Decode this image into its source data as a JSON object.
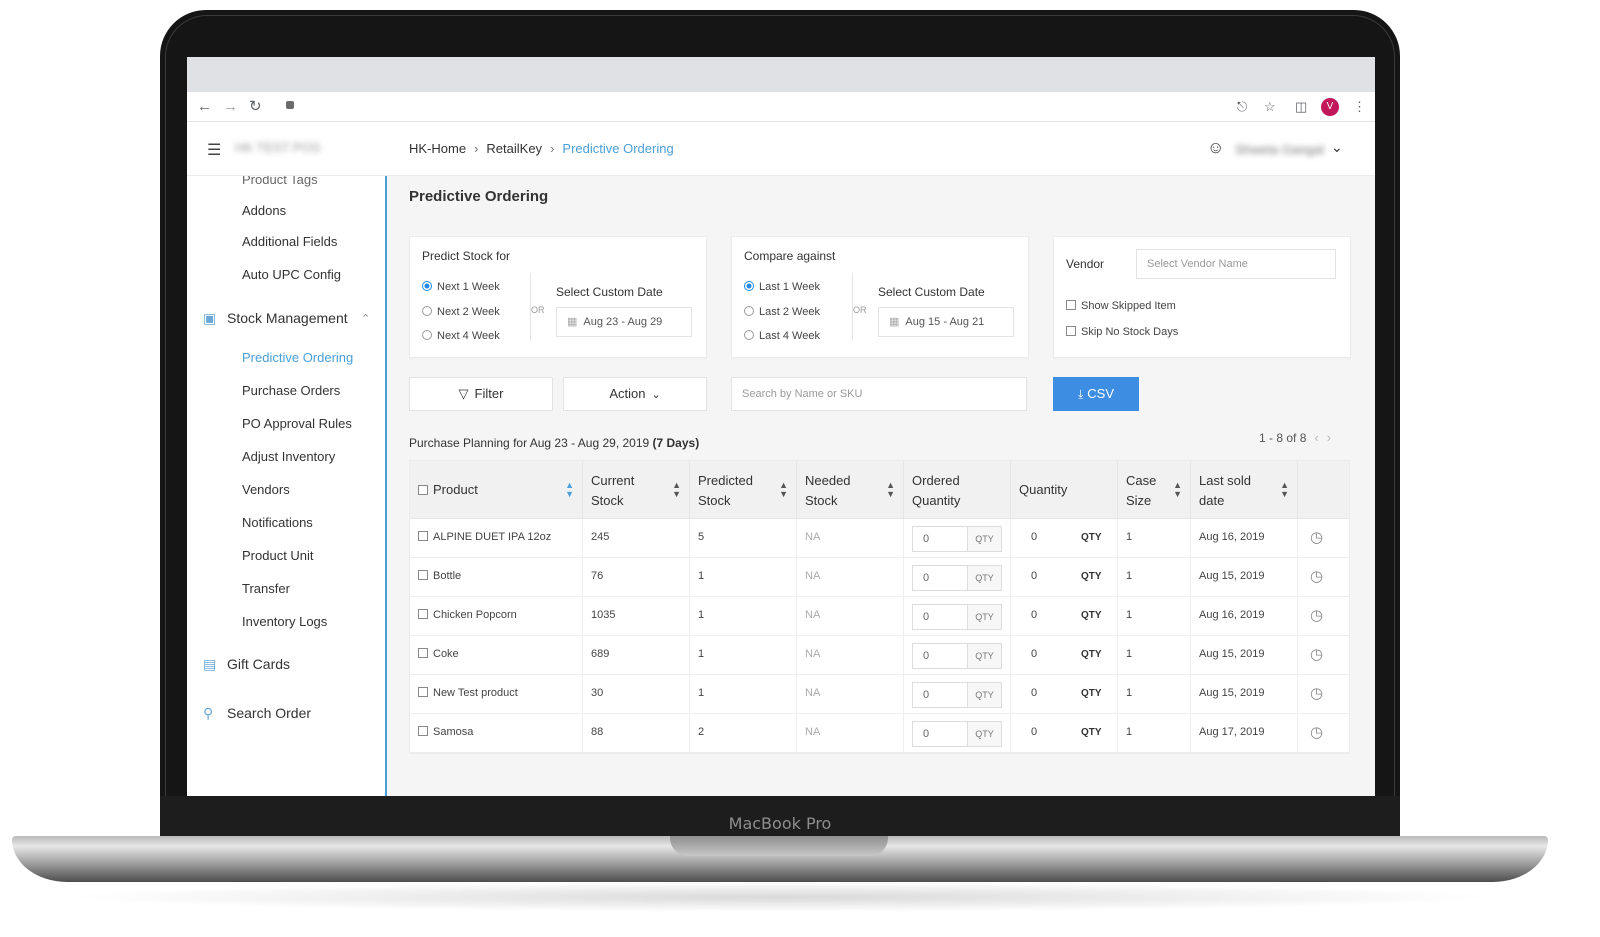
{
  "device": {
    "label": "MacBook Pro"
  },
  "browser": {
    "profile_initial": "V"
  },
  "header": {
    "store_name": "HK TEST POS",
    "breadcrumb": [
      "HK-Home",
      "RetailKey",
      "Predictive Ordering"
    ],
    "user_name": "Shweta Gangal"
  },
  "sidebar": {
    "items_top": [
      "Product Tags",
      "Addons",
      "Additional Fields",
      "Auto UPC Config"
    ],
    "group_stock": "Stock Management",
    "stock_items": [
      "Predictive Ordering",
      "Purchase Orders",
      "PO Approval Rules",
      "Adjust Inventory",
      "Vendors",
      "Notifications",
      "Product Unit",
      "Transfer",
      "Inventory Logs"
    ],
    "group_gift": "Gift Cards",
    "group_search": "Search Order"
  },
  "page": {
    "title": "Predictive Ordering"
  },
  "predict": {
    "title": "Predict Stock for",
    "options": [
      "Next 1 Week",
      "Next 2 Week",
      "Next 4 Week"
    ],
    "or": "OR",
    "custom_title": "Select Custom Date",
    "date": "Aug 23 - Aug 29"
  },
  "compare": {
    "title": "Compare against",
    "options": [
      "Last 1 Week",
      "Last 2 Week",
      "Last 4 Week"
    ],
    "or": "OR",
    "custom_title": "Select Custom Date",
    "date": "Aug 15 - Aug 21"
  },
  "vendor": {
    "label": "Vendor",
    "placeholder": "Select Vendor Name",
    "show_skipped": "Show Skipped Item",
    "skip_no_stock": "Skip No Stock Days"
  },
  "toolbar": {
    "filter": "Filter",
    "action": "Action",
    "search_placeholder": "Search by Name or SKU",
    "csv": "CSV"
  },
  "planning": {
    "prefix": "Purchase Planning for Aug 23 - Aug 29, 2019 ",
    "days": "(7 Days)"
  },
  "pager": {
    "text": "1 - 8 of 8"
  },
  "table": {
    "headers": {
      "product": "Product",
      "current_1": "Current",
      "current_2": "Stock",
      "predicted_1": "Predicted",
      "predicted_2": "Stock",
      "needed_1": "Needed",
      "needed_2": "Stock",
      "ordered_1": "Ordered",
      "ordered_2": "Quantity",
      "quantity": "Quantity",
      "case_1": "Case",
      "case_2": "Size",
      "last_1": "Last sold",
      "last_2": "date"
    },
    "qty_unit": "QTY",
    "rows": [
      {
        "product": "ALPINE DUET IPA 12oz",
        "current": "245",
        "predicted": "5",
        "needed": "NA",
        "ordered": "0",
        "quantity": "0",
        "case": "1",
        "last_sold": "Aug 16, 2019"
      },
      {
        "product": "Bottle",
        "current": "76",
        "predicted": "1",
        "needed": "NA",
        "ordered": "0",
        "quantity": "0",
        "case": "1",
        "last_sold": "Aug 15, 2019"
      },
      {
        "product": "Chicken Popcorn",
        "current": "1035",
        "predicted": "1",
        "needed": "NA",
        "ordered": "0",
        "quantity": "0",
        "case": "1",
        "last_sold": "Aug 16, 2019"
      },
      {
        "product": "Coke",
        "current": "689",
        "predicted": "1",
        "needed": "NA",
        "ordered": "0",
        "quantity": "0",
        "case": "1",
        "last_sold": "Aug 15, 2019"
      },
      {
        "product": "New Test product",
        "current": "30",
        "predicted": "1",
        "needed": "NA",
        "ordered": "0",
        "quantity": "0",
        "case": "1",
        "last_sold": "Aug 15, 2019"
      },
      {
        "product": "Samosa",
        "current": "88",
        "predicted": "2",
        "needed": "NA",
        "ordered": "0",
        "quantity": "0",
        "case": "1",
        "last_sold": "Aug 17, 2019"
      }
    ]
  },
  "colors": {
    "accent": "#4a9fd8",
    "button_primary": "#3d8ee3",
    "profile": "#c2185b"
  }
}
